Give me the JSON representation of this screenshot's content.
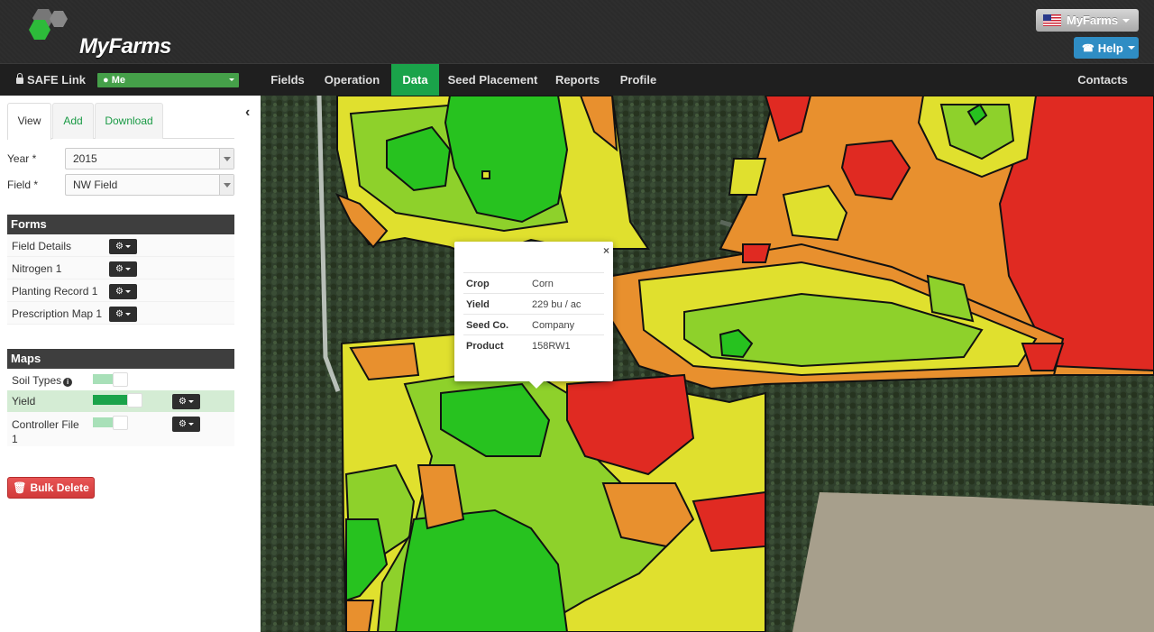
{
  "header": {
    "logo_text": "MyFarms",
    "account_button": "MyFarms",
    "help_button": "Help"
  },
  "nav": {
    "safe_link": "SAFE Link",
    "user_select": "Me",
    "items": [
      "Fields",
      "Operation",
      "Data",
      "Seed Placement",
      "Reports",
      "Profile"
    ],
    "active": "Data",
    "contacts": "Contacts"
  },
  "sidebar": {
    "tabs": [
      "View",
      "Add",
      "Download"
    ],
    "active_tab": "View",
    "year_label": "Year *",
    "year_value": "2015",
    "field_label": "Field *",
    "field_value": "NW Field",
    "forms_title": "Forms",
    "forms": [
      "Field Details",
      "Nitrogen 1",
      "Planting Record 1",
      "Prescription Map 1"
    ],
    "maps_title": "Maps",
    "maps": [
      {
        "label": "Soil Types",
        "on": false
      },
      {
        "label": "Yield",
        "on": true
      },
      {
        "label": "Controller File 1",
        "on": false
      }
    ],
    "bulk_delete": "Bulk Delete"
  },
  "popup": {
    "rows": [
      {
        "key": "Crop",
        "value": "Corn"
      },
      {
        "key": "Yield",
        "value": "229 bu / ac"
      },
      {
        "key": "Seed Co.",
        "value": "Company"
      },
      {
        "key": "Product",
        "value": "158RW1"
      }
    ]
  },
  "colors": {
    "brand_green": "#1aa34a",
    "help_blue": "#2f8dc4",
    "delete_red": "#d23a3a",
    "yield_high": "#27c21f",
    "yield_mid_high": "#8ed12b",
    "yield_mid": "#e0e02e",
    "yield_mid_low": "#e8902e",
    "yield_low": "#e02a22"
  }
}
